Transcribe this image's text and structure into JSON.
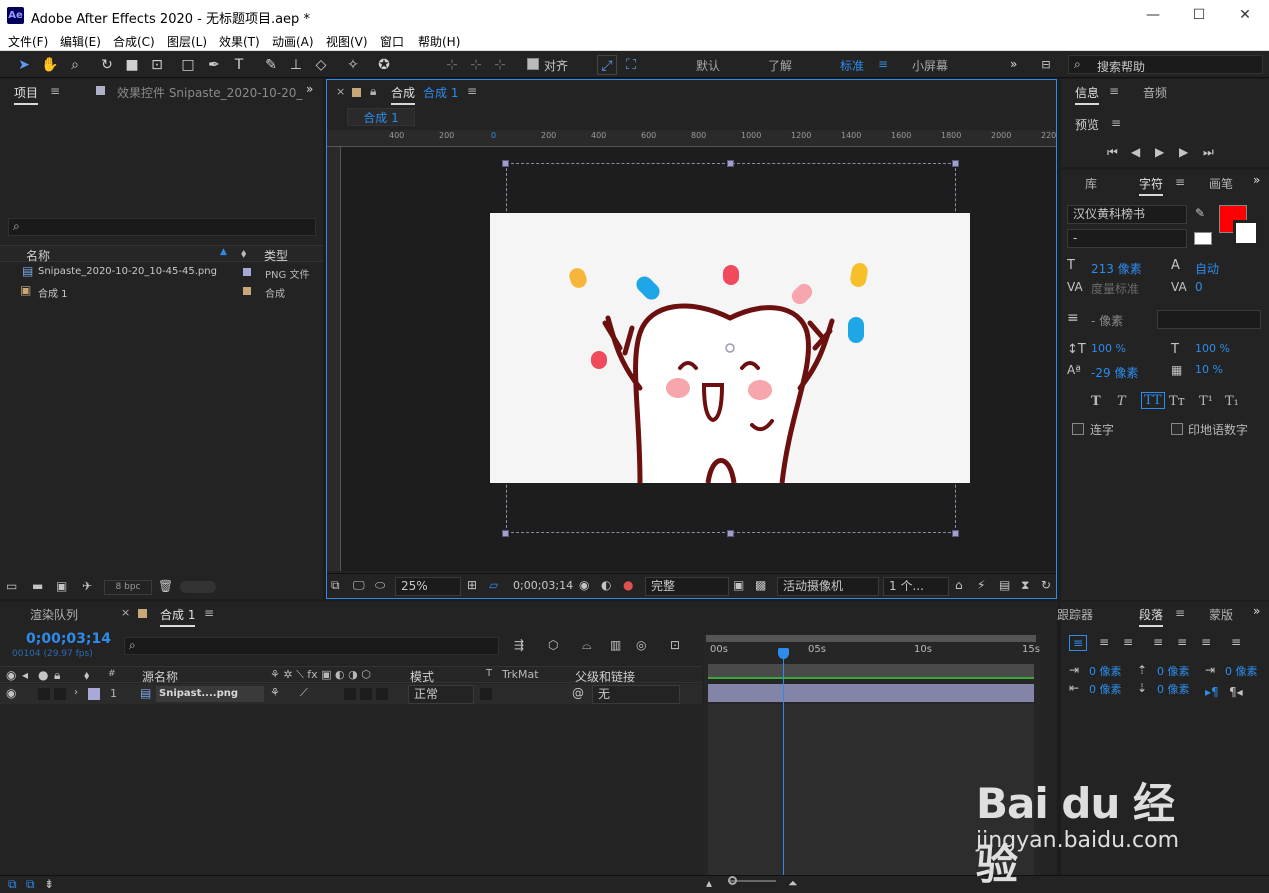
{
  "window": {
    "title": "Adobe After Effects 2020 - 无标题项目.aep *",
    "app_icon": "Ae",
    "minimize": "—",
    "maximize": "☐",
    "close": "✕"
  },
  "menu": [
    "文件(F)",
    "编辑(E)",
    "合成(C)",
    "图层(L)",
    "效果(T)",
    "动画(A)",
    "视图(V)",
    "窗口",
    "帮助(H)"
  ],
  "toolbar": {
    "snap_label": "对齐",
    "workspaces": [
      "默认",
      "了解",
      "标准",
      "小屏幕"
    ],
    "search_placeholder": "搜索帮助"
  },
  "project_panel": {
    "tab_project": "项目",
    "tab_effects": "效果控件 Snipaste_2020-10-20_",
    "search_placeholder": "",
    "col_name": "名称",
    "col_type": "类型",
    "items": [
      {
        "name": "Snipaste_2020-10-20_10-45-45.png",
        "type": "PNG 文件",
        "color": "#a9a9d8"
      },
      {
        "name": "合成 1",
        "type": "合成",
        "color": "#c8a878"
      }
    ],
    "bpc": "8 bpc"
  },
  "comp_panel": {
    "tab_label": "合成",
    "comp_name": "合成 1",
    "subtab": "合成 1",
    "ruler_ticks": [
      "400",
      "200",
      "0",
      "200",
      "400",
      "600",
      "800",
      "1000",
      "1200",
      "1400",
      "1600",
      "1800",
      "2000",
      "220"
    ],
    "zoom": "25%",
    "timecode": "0;00;03;14",
    "resolution": "完整",
    "camera": "活动摄像机",
    "views": "1 个...",
    "image_colors": {
      "bg": "#f5f5f5",
      "outline": "#6b0f0f",
      "cheek": "#f7a6ad"
    }
  },
  "right_panel": {
    "tab_info": "信息",
    "tab_audio": "音频",
    "preview_label": "预览",
    "tab_library": "库",
    "tab_character": "字符",
    "tab_paint": "画笔",
    "font_family": "汉仪黄科榜书",
    "font_style": "-",
    "font_size": "213 像素",
    "leading": "自动",
    "kerning": "度量标准",
    "tracking": "0",
    "stroke_width": "- 像素",
    "vscale": "100 %",
    "hscale": "100 %",
    "baseline": "-29 像素",
    "tsume": "10 %",
    "text_buttons": [
      "T",
      "T",
      "TT",
      "Tт",
      "T¹",
      "T₁"
    ],
    "ligatures": "连字",
    "hindi_digits": "印地语数字",
    "fill_color": "#ff0000",
    "tab_tracker": "跟踪器",
    "tab_paragraph": "段落",
    "tab_mask": "蒙版",
    "para_values": [
      "0 像素",
      "0 像素",
      "0 像素",
      "0 像素",
      "0 像素"
    ]
  },
  "timeline": {
    "tab_render": "渲染队列",
    "tab_comp": "合成 1",
    "timecode": "0;00;03;14",
    "frame_info": "00104 (29.97 fps)",
    "search_placeholder": "",
    "col_source": "源名称",
    "col_mode": "模式",
    "col_t": "T",
    "col_trkmat": "TrkMat",
    "col_parent": "父级和链接",
    "layer": {
      "index": "1",
      "name": "Snipast....png",
      "mode": "正常",
      "parent": "无",
      "label_color": "#a9a9d8"
    },
    "time_labels": [
      "00s",
      "05s",
      "10s",
      "15s"
    ],
    "playhead_fraction": 0.23
  },
  "watermark": {
    "brand": "Bai du 经验",
    "url": "jingyan.baidu.com"
  }
}
